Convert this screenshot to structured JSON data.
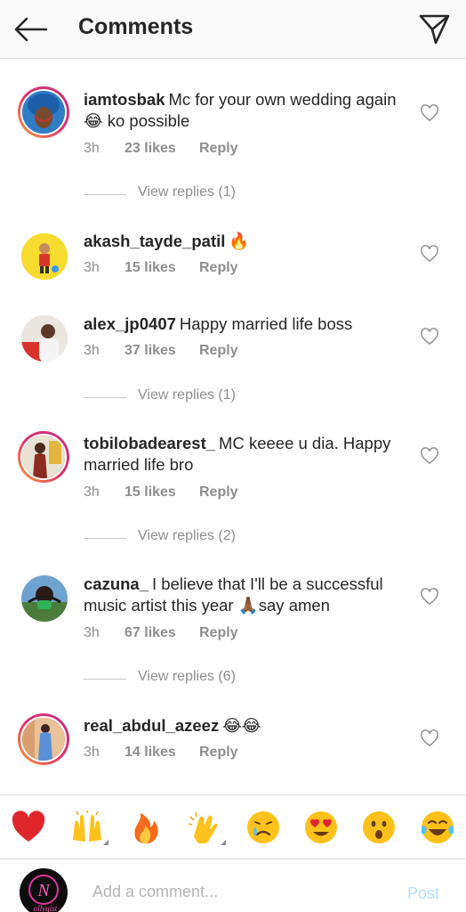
{
  "header": {
    "title": "Comments"
  },
  "comments": [
    {
      "user": "iamtosbak",
      "text": "Mc for your own wedding again 😂 ko possible",
      "time": "3h",
      "likes": "23 likes",
      "reply": "Reply",
      "view_replies": "View replies (1)"
    },
    {
      "user": "akash_tayde_patil",
      "text": "🔥",
      "time": "3h",
      "likes": "15 likes",
      "reply": "Reply"
    },
    {
      "user": "alex_jp0407",
      "text": "Happy married life boss",
      "time": "3h",
      "likes": "37 likes",
      "reply": "Reply",
      "view_replies": "View replies (1)"
    },
    {
      "user": "tobilobadearest_",
      "text": "MC keeee u dia. Happy married life bro",
      "time": "3h",
      "likes": "15 likes",
      "reply": "Reply",
      "view_replies": "View replies (2)"
    },
    {
      "user": "cazuna_",
      "text": "I believe that I'll be a successful music artist this year 🙏🏾say amen",
      "time": "3h",
      "likes": "67 likes",
      "reply": "Reply",
      "view_replies": "View replies (6)"
    },
    {
      "user": "real_abdul_azeez",
      "text": "😂😂",
      "time": "3h",
      "likes": "14 likes",
      "reply": "Reply"
    }
  ],
  "composer": {
    "placeholder": "Add a comment...",
    "post_label": "Post",
    "avatar_text": "N",
    "avatar_caption": "ollygist"
  },
  "emoji_bar": [
    "heart",
    "raising-hands",
    "fire",
    "clapping-hands",
    "crying-face",
    "heart-eyes",
    "surprised-face",
    "tears-of-joy"
  ]
}
